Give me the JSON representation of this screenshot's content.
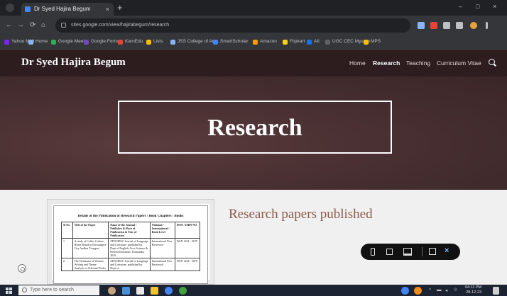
{
  "browser": {
    "tab_title": "Dr Syed Hajira Begum",
    "tab_close": "×",
    "new_tab": "+",
    "url": "sites.google.com/view/hajirabegum/research",
    "window_controls": {
      "minimize": "–",
      "maximize": "□",
      "close": "×"
    },
    "nav": {
      "back": "←",
      "forward": "→",
      "reload": "⟳",
      "home": "⌂"
    },
    "bookmarks": [
      {
        "label": "Yahoo Mail",
        "color": "#7e1fff"
      },
      {
        "label": "Home",
        "color": "#8ab4f8"
      },
      {
        "label": "Google Meet",
        "color": "#34a853"
      },
      {
        "label": "Google Forms",
        "color": "#7248b9"
      },
      {
        "label": "KarnEdu",
        "color": "#ea4335"
      },
      {
        "label": "Lists",
        "color": "#fbbc04"
      },
      {
        "label": "JSS College of Arts...",
        "color": "#8ab4f8"
      },
      {
        "label": "SmartScholar",
        "color": "#4285f4"
      },
      {
        "label": "Amazon",
        "color": "#ff9900"
      },
      {
        "label": "Flipkart",
        "color": "#f7d117"
      },
      {
        "label": "AII",
        "color": "#1a73e8"
      },
      {
        "label": "UGC CEC Mysore",
        "color": "#5f6368"
      },
      {
        "label": "MPS",
        "color": "#fbbc04"
      }
    ]
  },
  "site": {
    "title": "Dr Syed Hajira Begum",
    "nav": [
      "Home",
      "Research",
      "Teaching",
      "Curriculum Vitae"
    ],
    "active_nav": "Research",
    "hero_title": "Research",
    "section_heading": "Research papers published",
    "document": {
      "heading": "Details of the Publication of Research Papers / Book Chapters / Books",
      "columns": [
        "Sl No",
        "Title of the Paper",
        "Name of the Journal / Publisher & Place of Publication & Year of Publication",
        "National / International / Book Level",
        "ISSN / ISBN NO"
      ],
      "rows": [
        [
          "1",
          "A study of Coffee Culture Home Based in Davanagere City Andhra Tiruppur",
          "ZENUIPAC Journal of Language and Literature, published by Dept of English, Govt Science & Research Institute, Karnataka, 2019",
          "International Peer Reviewed",
          "ISSN 1234 - 5678"
        ],
        [
          "2",
          "The Dynamics of Women Writing and Theme Analysis of Selected Works",
          "ZENUIPAC Journal of Language and Literature, published by Dept of",
          "International Peer Reviewed",
          "ISSN 1234 - 5678"
        ]
      ]
    }
  },
  "toolbar": {
    "close": "×"
  },
  "taskbar": {
    "search_placeholder": "Type here to search",
    "time": "04:11 PM",
    "date": "28-12-23"
  }
}
